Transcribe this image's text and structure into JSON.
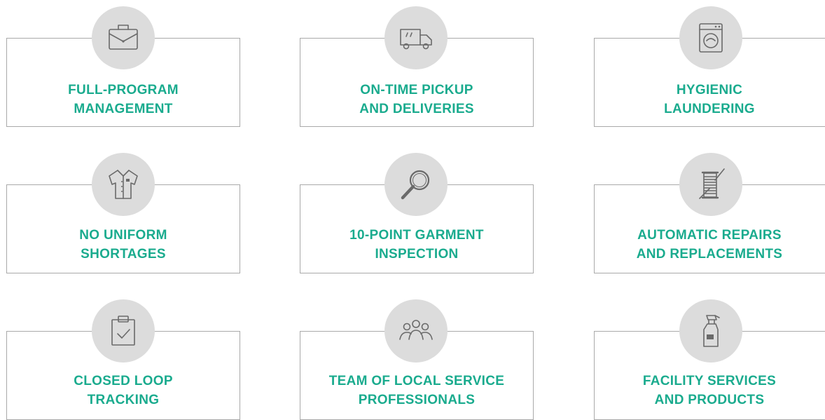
{
  "services": [
    {
      "line1": "FULL-PROGRAM",
      "line2": "MANAGEMENT",
      "icon": "briefcase-icon"
    },
    {
      "line1": "ON-TIME PICKUP",
      "line2": "AND DELIVERIES",
      "icon": "delivery-truck-icon"
    },
    {
      "line1": "HYGIENIC",
      "line2": "LAUNDERING",
      "icon": "washing-machine-icon"
    },
    {
      "line1": "NO UNIFORM",
      "line2": "SHORTAGES",
      "icon": "uniform-shirt-icon"
    },
    {
      "line1": "10-POINT GARMENT",
      "line2": "INSPECTION",
      "icon": "magnifying-glass-icon"
    },
    {
      "line1": "AUTOMATIC REPAIRS",
      "line2": "AND REPLACEMENTS",
      "icon": "thread-spool-needle-icon"
    },
    {
      "line1": "CLOSED LOOP",
      "line2": "TRACKING",
      "icon": "clipboard-check-icon"
    },
    {
      "line1": "TEAM OF LOCAL SERVICE",
      "line2": "PROFESSIONALS",
      "icon": "team-people-icon"
    },
    {
      "line1": "FACILITY SERVICES",
      "line2": "AND PRODUCTS",
      "icon": "spray-bottle-icon"
    }
  ],
  "colors": {
    "accent": "#1aab8e",
    "icon_bg": "#dcdcdc",
    "border": "#a9a9a9",
    "icon_stroke": "#6a6a6a"
  }
}
